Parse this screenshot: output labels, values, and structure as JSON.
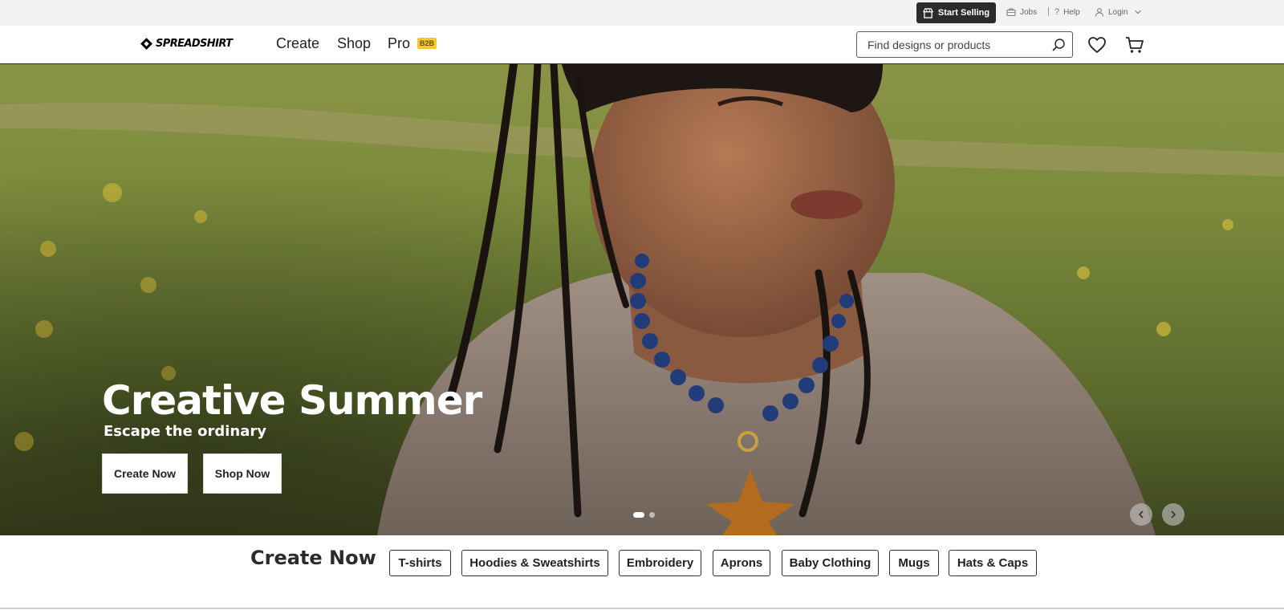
{
  "utility_bar": {
    "start_selling": "Start Selling",
    "jobs": "Jobs",
    "help": "Help",
    "login": "Login"
  },
  "header": {
    "logo_text": "SPREADSHIRT",
    "nav": [
      "Create",
      "Shop",
      "Pro"
    ],
    "b2b_badge": "B2B",
    "search_placeholder": "Find designs or products"
  },
  "hero": {
    "title": "Creative Summer",
    "subtitle": "Escape the ordinary",
    "buttons": [
      "Create Now",
      "Shop Now"
    ],
    "slide_count": 2,
    "active_slide": 1
  },
  "create_now": {
    "title": "Create Now",
    "categories": [
      "T-shirts",
      "Hoodies & Sweatshirts",
      "Embroidery",
      "Aprons",
      "Baby Clothing",
      "Mugs",
      "Hats & Caps"
    ]
  },
  "colors": {
    "accent_badge": "#f6c82f",
    "dark_button": "#2b2b2b"
  }
}
